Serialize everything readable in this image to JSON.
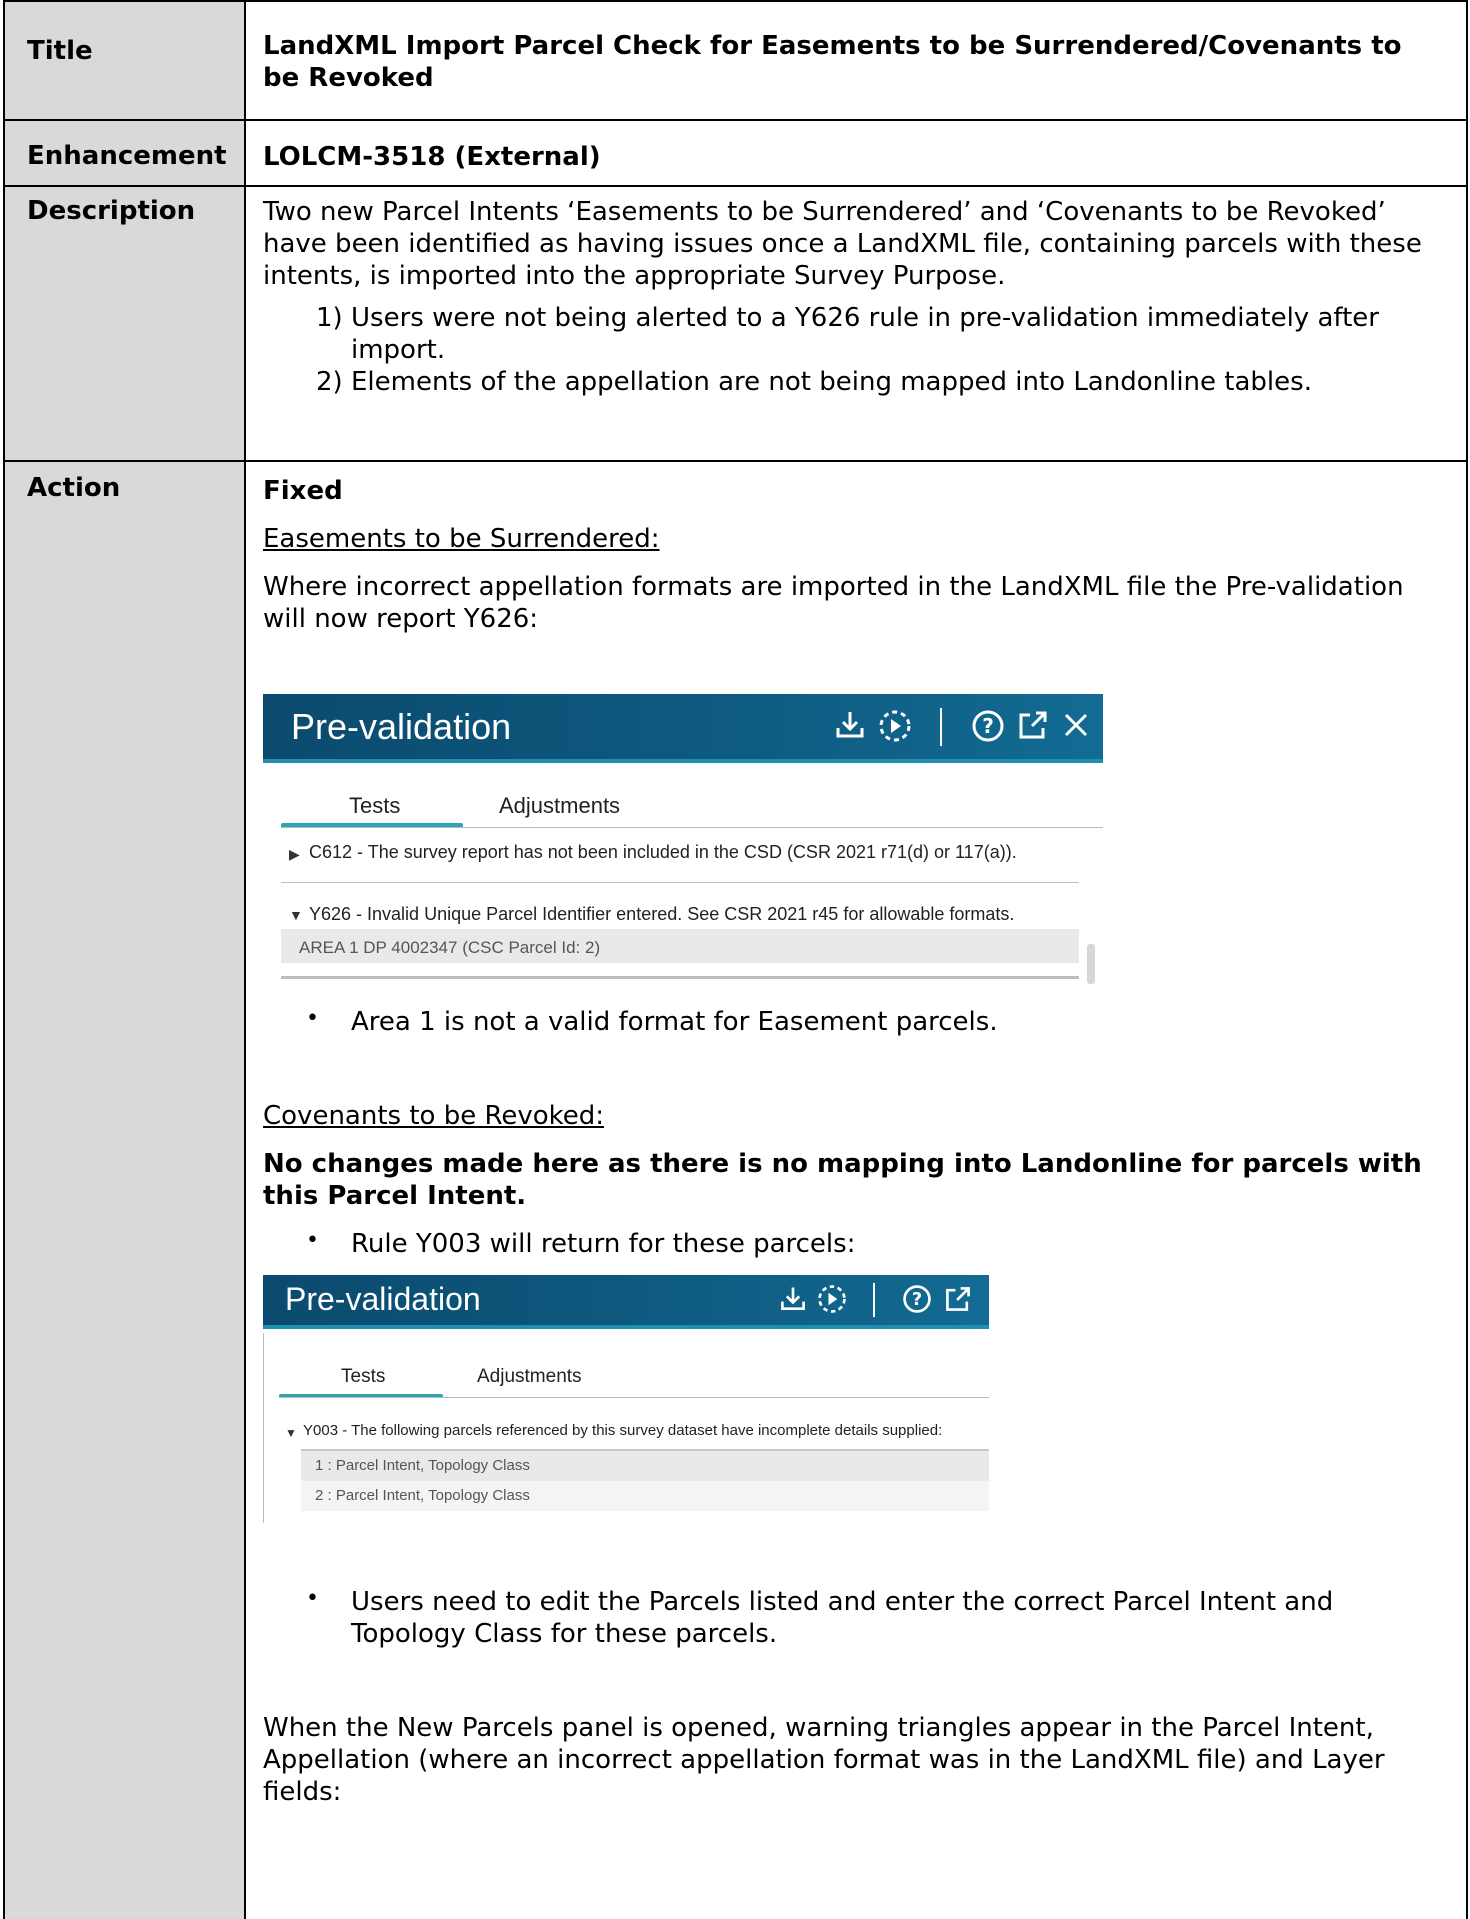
{
  "rows": {
    "title": {
      "label": "Title",
      "value_line1": "LandXML Import Parcel Check for Easements to be Surrendered/Covenants to",
      "value_line2": "be Revoked"
    },
    "enhancement": {
      "label": "Enhancement",
      "value": "LOLCM-3518 (External)"
    },
    "description": {
      "label": "Description",
      "lines": [
        "Two new Parcel Intents ‘Easements to be Surrendered’ and ‘Covenants to be Revoked’",
        "have been identified as having issues once a LandXML file, containing parcels with these",
        "intents, is imported into the appropriate Survey Purpose."
      ],
      "items": [
        {
          "number": "1)",
          "line1": "Users were not being alerted to a Y626 rule in pre-validation immediately after",
          "line2": "import."
        },
        {
          "number": "2)",
          "line1": "Elements of the appellation are not being mapped into Landonline tables.",
          "line2": ""
        }
      ]
    },
    "action": {
      "label": "Action",
      "status": "Fixed",
      "easements_heading": "Easements to be Surrendered:",
      "easements_text_line1": "Where incorrect appellation formats are imported in the LandXML file the Pre-validation",
      "easements_text_line2": "will now report Y626:",
      "easements_bullet": "Area 1 is not a valid format for Easement parcels.",
      "covenants_heading": "Covenants to be Revoked:",
      "covenants_bold_line1": "No changes made here as there is no mapping into Landonline for parcels with",
      "covenants_bold_line2": "this Parcel Intent.",
      "covenants_bullet": "Rule Y003 will return for these parcels:",
      "edit_bullet_line1": "Users need to edit the Parcels listed and enter the correct Parcel Intent and",
      "edit_bullet_line2": "Topology Class for these parcels.",
      "closing_line1": "When the New Parcels panel is opened, warning triangles appear in the Parcel Intent,",
      "closing_line2": "Appellation (where an incorrect appellation format was in the LandXML file) and Layer",
      "closing_line3": "fields:"
    }
  },
  "prevalidation_1": {
    "title": "Pre-validation",
    "icons": [
      "download-icon",
      "run-icon",
      "help-icon",
      "popout-icon",
      "close-icon"
    ],
    "tabs": [
      "Tests",
      "Adjustments"
    ],
    "active_tab": "Tests",
    "rules": [
      {
        "code_text": "C612 - The survey report has not been included in the CSD (CSR 2021 r71(d) or 117(a)).",
        "expanded": false
      },
      {
        "code_text": "Y626 - Invalid Unique Parcel Identifier entered. See CSR 2021 r45 for allowable formats.",
        "expanded": true
      }
    ],
    "details": [
      "AREA 1 DP 4002347 (CSC Parcel Id: 2)"
    ]
  },
  "prevalidation_2": {
    "title": "Pre-validation",
    "icons": [
      "download-icon",
      "run-icon",
      "help-icon",
      "popout-icon"
    ],
    "tabs": [
      "Tests",
      "Adjustments"
    ],
    "active_tab": "Tests",
    "rules": [
      {
        "code_text": "Y003 - The following parcels referenced by this survey dataset have incomplete details supplied:",
        "expanded": true
      }
    ],
    "details": [
      "1 : Parcel Intent, Topology Class",
      "2 : Parcel Intent, Topology Class"
    ]
  },
  "colors": {
    "label_bg": "#d9d9d9",
    "header_dark": "#0b4a6e",
    "header_light": "#136b93",
    "tab_accent": "#2aa6b4"
  }
}
